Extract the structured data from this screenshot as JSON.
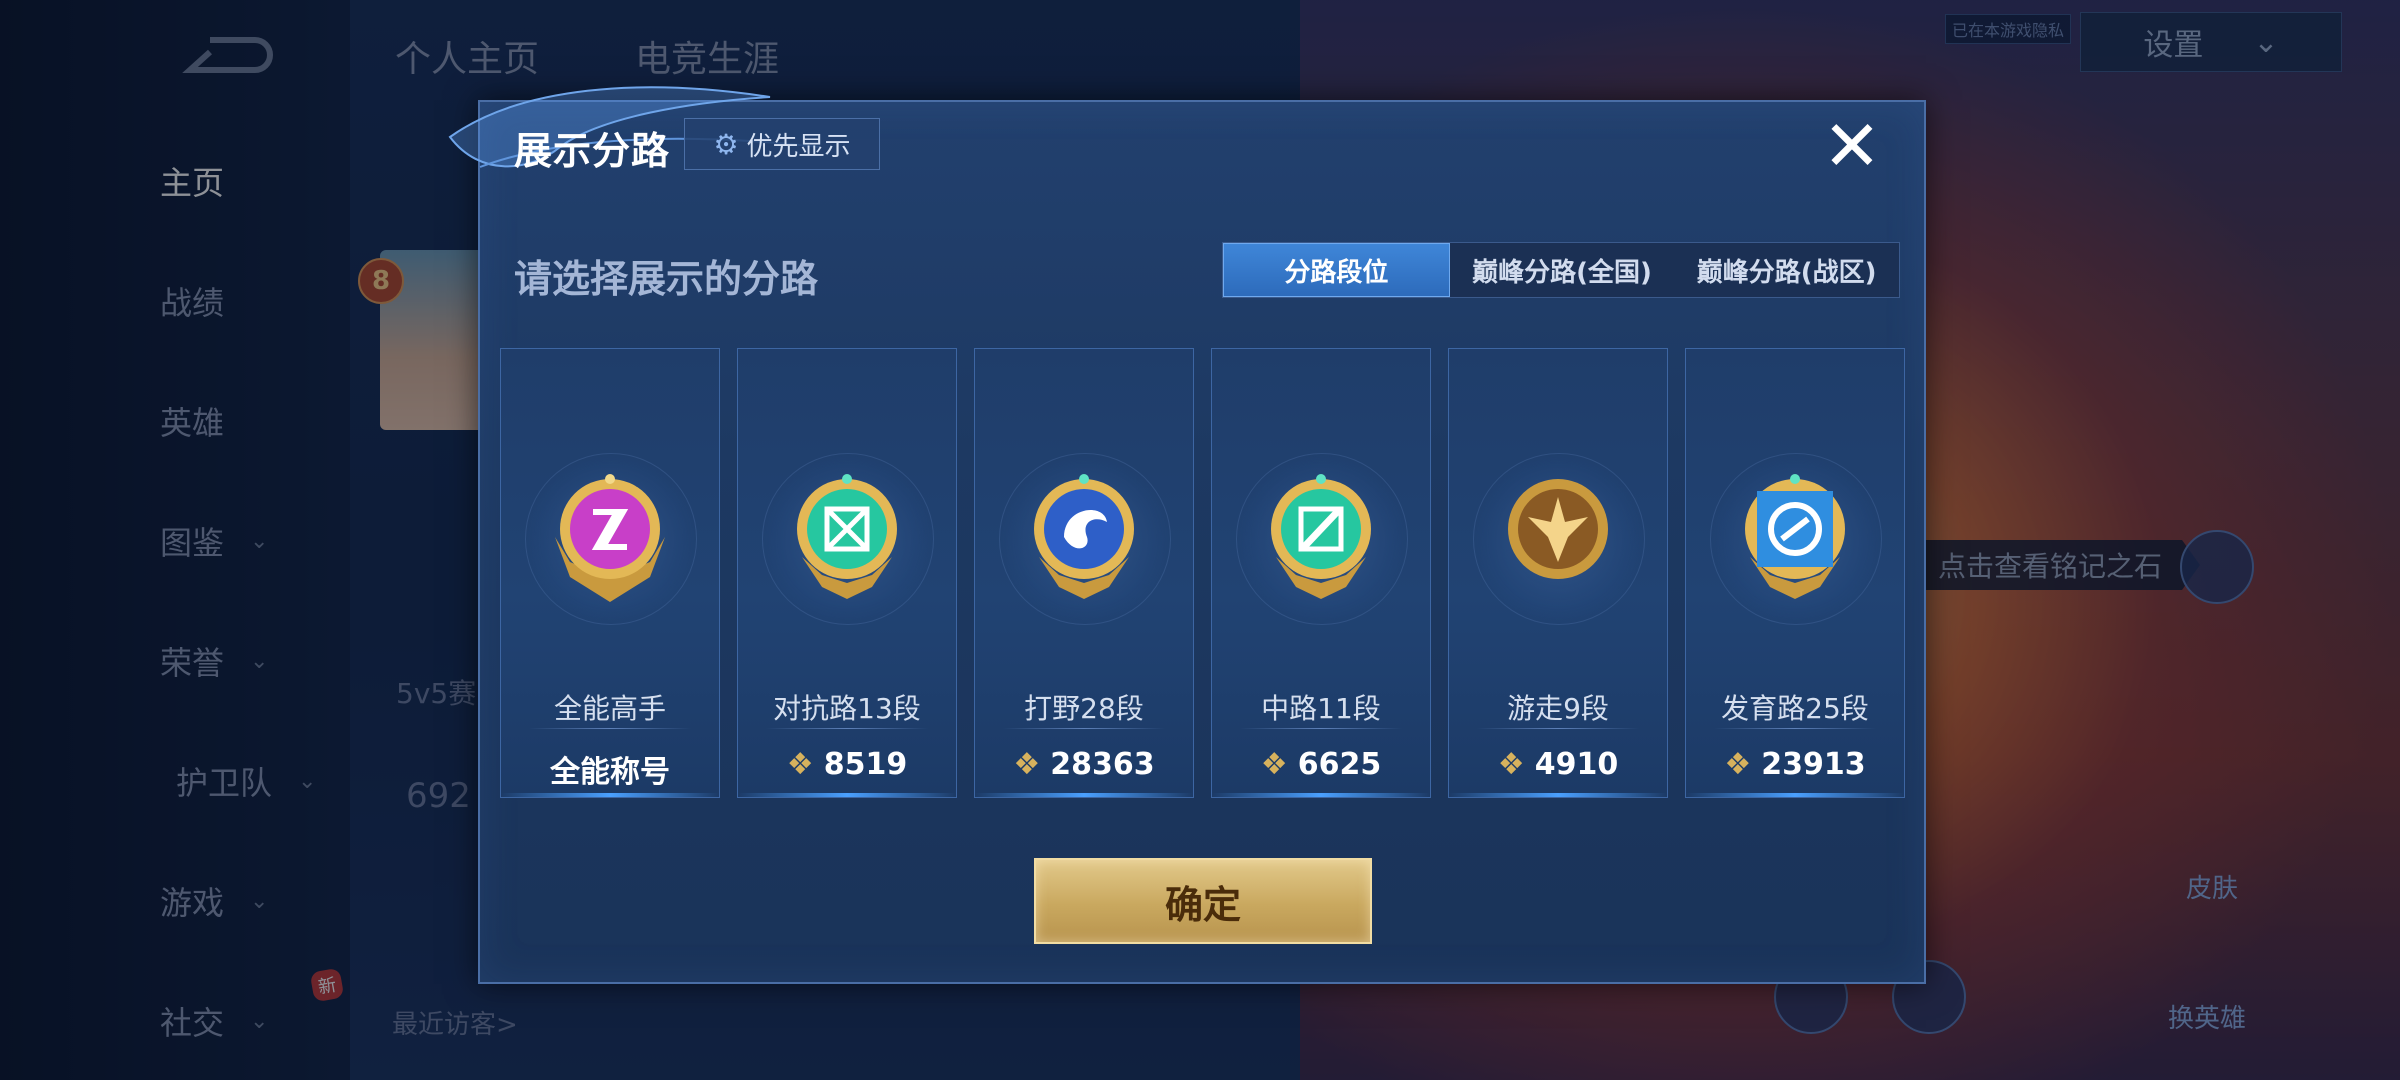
{
  "sidebar": {
    "items": [
      {
        "label": "主页"
      },
      {
        "label": "战绩"
      },
      {
        "label": "英雄"
      },
      {
        "label": "图鉴"
      },
      {
        "label": "荣誉"
      },
      {
        "label": "护卫队"
      },
      {
        "label": "游戏"
      },
      {
        "label": "社交"
      }
    ],
    "new_badge": "新"
  },
  "header": {
    "tabs": [
      "个人主页",
      "电竞生涯"
    ],
    "settings_label": "设置",
    "small_note": "已在本游戏隐私"
  },
  "background": {
    "level": "8",
    "mode_text": "5v5赛",
    "number_text": "692",
    "recent_visitors": "最近访客>",
    "hint": "点击查看铭记之石",
    "side_buttons": [
      "皮肤",
      "换英雄"
    ]
  },
  "modal": {
    "title": "展示分路",
    "priority_label": "优先显示",
    "close_label": "✕",
    "subtitle": "请选择展示的分路",
    "tabs": [
      "分路段位",
      "巅峰分路(全国)",
      "巅峰分路(战区)"
    ],
    "active_tab": "分路段位",
    "confirm_label": "确定",
    "cards": [
      {
        "name": "全能高手",
        "value": "全能称号",
        "emblem": "all-rounder-emblem",
        "color": "#c83fc8"
      },
      {
        "name": "对抗路13段",
        "value": "8519",
        "emblem": "clash-lane-emblem",
        "color": "#26c7a0"
      },
      {
        "name": "打野28段",
        "value": "28363",
        "emblem": "jungle-emblem",
        "color": "#2e5fc8"
      },
      {
        "name": "中路11段",
        "value": "6625",
        "emblem": "mid-lane-emblem",
        "color": "#26c7a0"
      },
      {
        "name": "游走9段",
        "value": "4910",
        "emblem": "roam-emblem",
        "color": "#b8833a"
      },
      {
        "name": "发育路25段",
        "value": "23913",
        "emblem": "farm-lane-emblem",
        "color": "#2f8ee0"
      }
    ]
  }
}
